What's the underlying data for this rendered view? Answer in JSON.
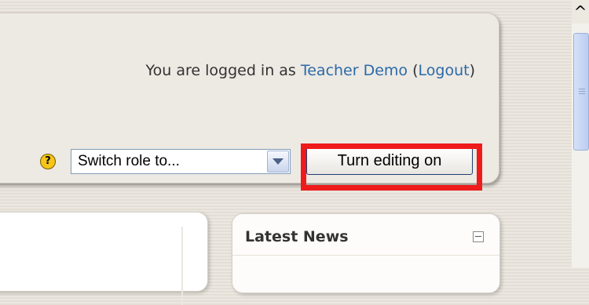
{
  "header": {
    "login_prefix": "You are logged in as ",
    "user_name": "Teacher Demo",
    "logout_open": " (",
    "logout_label": "Logout",
    "logout_close": ")"
  },
  "controls": {
    "help_icon": "?",
    "role_select_value": "Switch role to...",
    "edit_button_label": "Turn editing on"
  },
  "news_block": {
    "title": "Latest News",
    "collapse_icon": "collapse-icon"
  },
  "scrollbar": {
    "up_arrow": "^"
  },
  "colors": {
    "highlight": "#ef1a1a",
    "link": "#2b6aa8"
  }
}
